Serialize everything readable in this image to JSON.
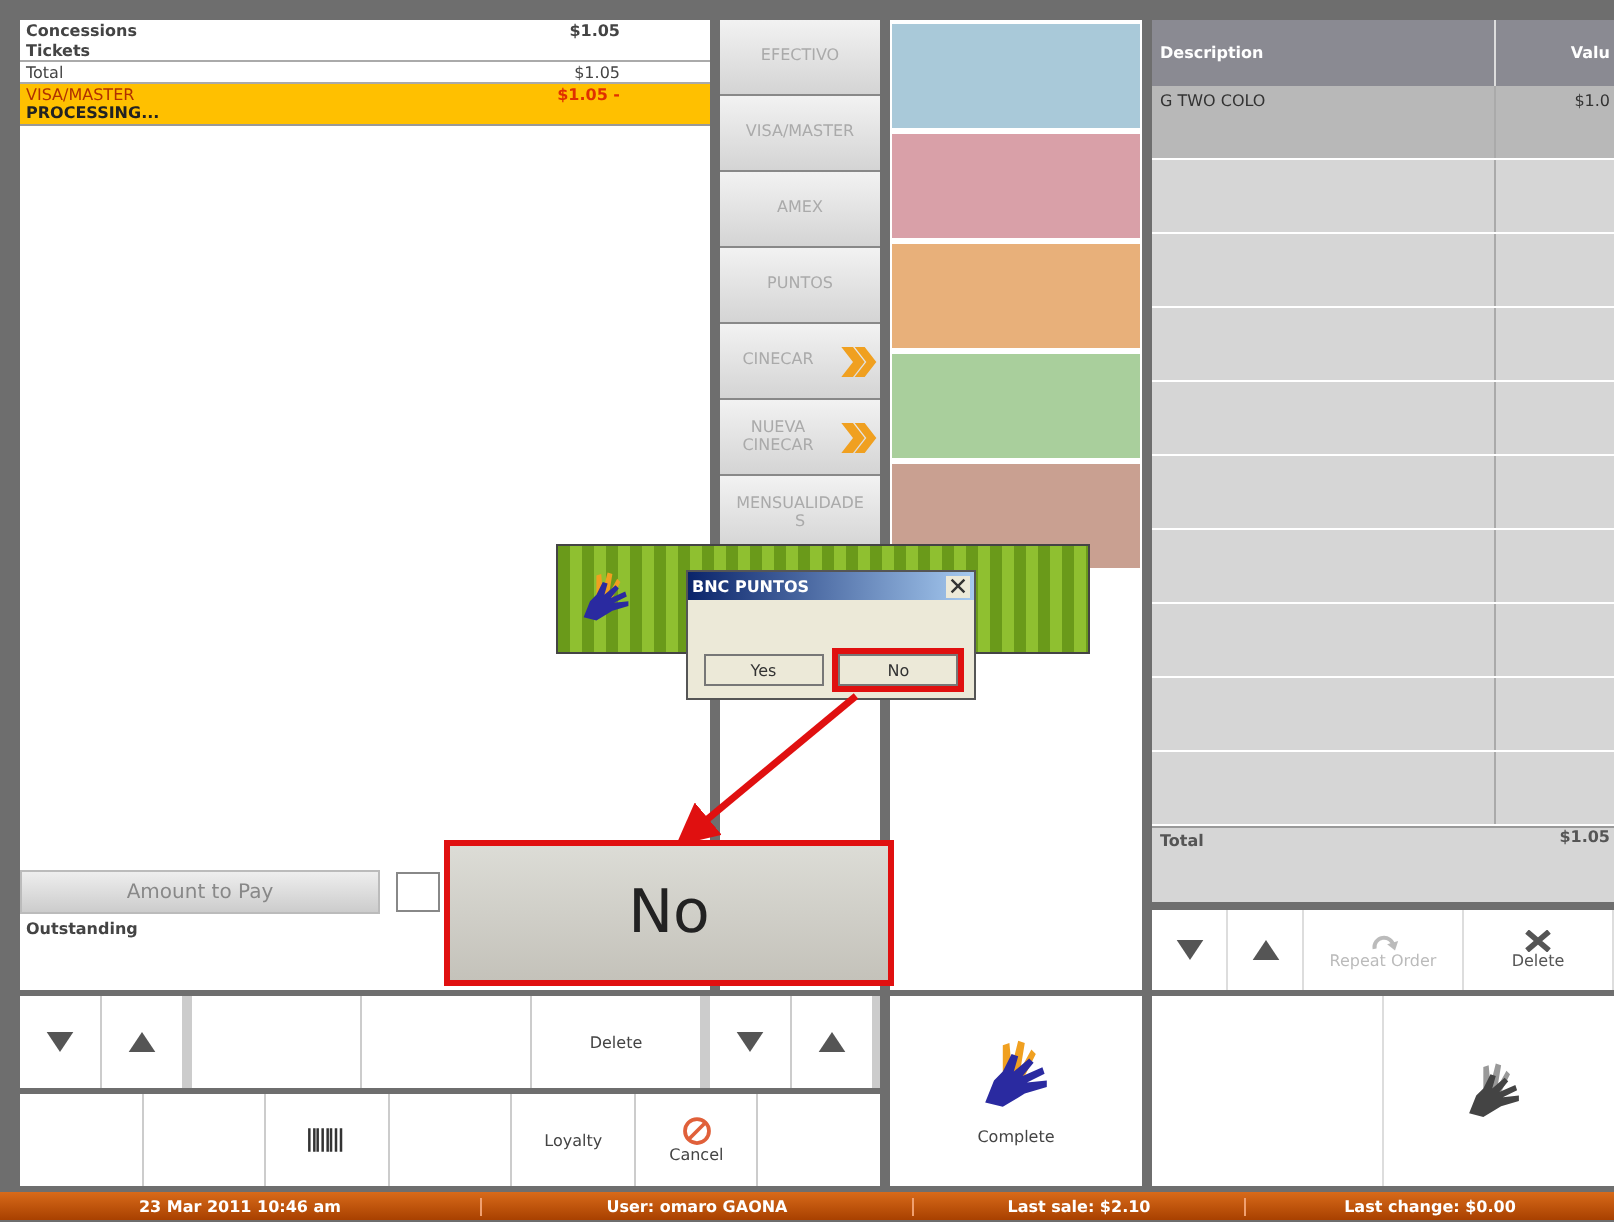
{
  "receipt": {
    "lines": [
      {
        "label": "Concessions",
        "amount": "$1.05",
        "kind": "item"
      },
      {
        "label": "Tickets",
        "kind": "item"
      },
      {
        "label": "Total",
        "amount": "$1.05",
        "kind": "total"
      }
    ],
    "payment": {
      "method": "VISA/MASTER",
      "amount": "$1.05 -",
      "status": "PROCESSING...",
      "selected": true
    },
    "amount_to_pay": "Amount to Pay",
    "outstanding": "Outstanding"
  },
  "payment_methods": [
    {
      "label": "EFECTIVO",
      "kind": "plain"
    },
    {
      "label": "VISA/MASTER",
      "kind": "plain"
    },
    {
      "label": "AMEX",
      "kind": "plain"
    },
    {
      "label": "PUNTOS",
      "kind": "plain"
    },
    {
      "label": "CINECAR",
      "kind": "arrow"
    },
    {
      "label": "NUEVA CINECAR",
      "kind": "arrow"
    },
    {
      "label": "MENSUALIDADES",
      "kind": "plain"
    }
  ],
  "banknotes": [
    {
      "color": "#a9c9d9"
    },
    {
      "color": "#d9a0a8"
    },
    {
      "color": "#e8b07a"
    },
    {
      "color": "#a9cf9c"
    },
    {
      "color": "#c9a091"
    }
  ],
  "order_table": {
    "columns": [
      "Description",
      "Valu"
    ],
    "rows": [
      {
        "description": "G TWO COLO",
        "value": "$1.0",
        "selected": true
      }
    ],
    "total": {
      "label": "Total",
      "value": "$1.05"
    }
  },
  "order_actions": [
    {
      "kind": "down"
    },
    {
      "kind": "up"
    },
    {
      "kind": "repeat",
      "label": "Repeat Order",
      "disabled": true
    },
    {
      "kind": "delete",
      "label": "Delete",
      "disabled": false
    }
  ],
  "action_row_top": [
    {
      "kind": "down"
    },
    {
      "kind": "up"
    },
    {
      "kind": "blank"
    },
    {
      "kind": "blank"
    },
    {
      "kind": "text",
      "label": "Delete"
    },
    {
      "kind": "down"
    },
    {
      "kind": "up"
    }
  ],
  "action_row_bottom": [
    {
      "kind": "blank"
    },
    {
      "kind": "blank"
    },
    {
      "kind": "barcode"
    },
    {
      "kind": "blank"
    },
    {
      "kind": "text",
      "label": "Loyalty"
    },
    {
      "kind": "cancel",
      "label": "Cancel"
    },
    {
      "kind": "blank"
    }
  ],
  "complete_button": {
    "label": "Complete"
  },
  "status_bar": [
    "23 Mar 2011 10:46 am",
    "User: omaro GAONA",
    "Last sale: $2.10",
    "Last change: $0.00"
  ],
  "dialog": {
    "title": "BNC PUNTOS",
    "buttons": [
      {
        "label": "Yes",
        "highlighted": false
      },
      {
        "label": "No",
        "highlighted": true
      }
    ]
  },
  "callout": {
    "label": "No"
  }
}
